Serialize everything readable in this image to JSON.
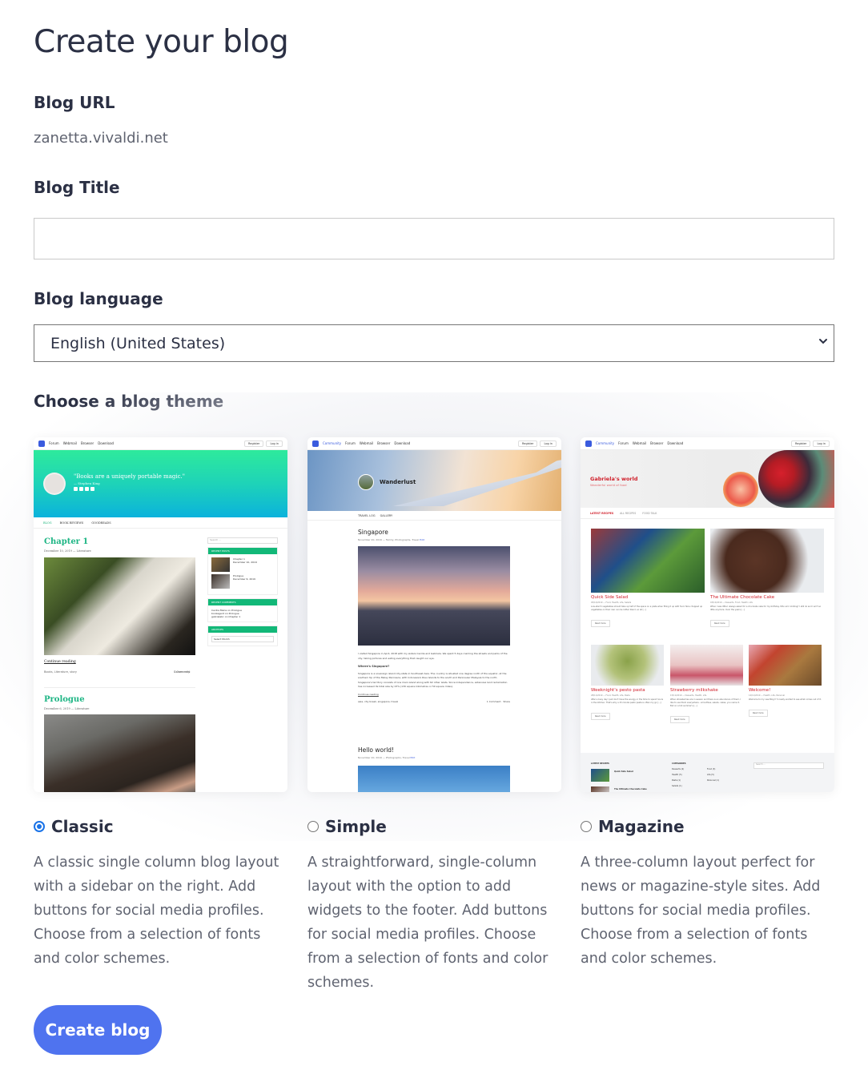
{
  "page": {
    "title": "Create your blog"
  },
  "blog_url": {
    "label": "Blog URL",
    "value": "zanetta.vivaldi.net"
  },
  "blog_title": {
    "label": "Blog Title",
    "value": ""
  },
  "blog_language": {
    "label": "Blog language",
    "selected": "English (United States)"
  },
  "themes": {
    "label": "Choose a blog theme",
    "selected": "Classic",
    "preview_nav": {
      "community": "Community",
      "forum": "Forum",
      "webmail": "Webmail",
      "browser": "Browser",
      "download": "Download",
      "register": "Register",
      "login": "Log in"
    },
    "items": [
      {
        "name": "Classic",
        "checked": true,
        "description": "A classic single column blog layout with a sidebar on the right. Add buttons for social media profiles. Choose from a selection of fonts and color schemes.",
        "preview": {
          "quote": "\"Books are a uniquely portable magic.\"",
          "quote_author": "— Stephen King",
          "nav": [
            "BLOG",
            "BOOK REVIEWS",
            "GOODREADS"
          ],
          "posts": [
            {
              "title": "Chapter 1",
              "meta": "December 10, 2019 — Literature",
              "continue": "Continue reading",
              "tags": "Books, Literature, story",
              "comments": "1 Comment",
              "share": "Share"
            },
            {
              "title": "Prologue",
              "meta": "December 6, 2019 — Literature"
            }
          ],
          "search_placeholder": "Search ...",
          "widgets": {
            "recent_posts": "RECENT POSTS",
            "recent_posts_items": [
              {
                "title": "Chapter 1",
                "date": "December 10, 2019"
              },
              {
                "title": "Prologue",
                "date": "December 6, 2019"
              }
            ],
            "recent_comments": "RECENT COMMENTS",
            "recent_comments_items": [
              "Cecilia Marie on Prologue",
              "bookagent on Prologue",
              "gabrielabc on Chapter 1"
            ],
            "archives": "ARCHIVES",
            "archives_select": "Select Month"
          }
        }
      },
      {
        "name": "Simple",
        "checked": false,
        "description": "A straightforward, single-column layout with the option to add widgets to the footer. Add buttons for social media profiles. Choose from a selection of fonts and color schemes.",
        "preview": {
          "blog_name": "Wanderlust",
          "nav": [
            "TRAVEL LOG",
            "GALLERY"
          ],
          "posts": [
            {
              "title": "Singapore",
              "meta": "November 20, 2019 — Family, Photographs, Travel",
              "edit": "Edit",
              "intro": "I visited Singapore in April, 2018 with my sisters Cecilia and Gabriela. We spent 5 days roaming the streets and parks of the city, taking pictures and eating everything that caught our eye.",
              "subheading": "Where's Singapore?",
              "body": "Singapore is a sovereign island city-state in Southeast Asia. The country is situated one degree north of the equator, at the southern tip of the Malay Peninsula, with Indonesia's Riau Islands to the south and Peninsular Malaysia to the north. Singapore's territory consists of one main island along with 62 other islets. Since independence, extensive land reclamation has increased its total size by 23% (130 square kilometres or 50 square miles).",
              "continue": "Continue reading",
              "tags": "asia, city break, singapore, travel",
              "comments": "1 Comment",
              "share": "Share"
            },
            {
              "title": "Hello world!",
              "meta": "November 20, 2019 — Photographs, Travel",
              "edit": "Edit"
            }
          ]
        }
      },
      {
        "name": "Magazine",
        "checked": false,
        "description": "A three-column layout perfect for news or magazine-style sites. Add buttons for social media profiles. Choose from a selection of fonts and color schemes.",
        "preview": {
          "blog_name": "Gabriela's world",
          "tagline": "Wonderful world of food",
          "nav": [
            "LATEST RECIPES",
            "ALL RECIPES",
            "FOOD TALK"
          ],
          "posts": [
            {
              "title": "Quick Side Salad",
              "meta": "05/12/2019 — Food, Health, Life, Salads",
              "excerpt": "Low-starch vegetables should take up half of the space on a plate when filling it up with food. Nice chopped up vegetables on their own can be rather bland, so all [...]",
              "more": "Read more"
            },
            {
              "title": "The Ultimate Chocolate Cake",
              "meta": "03/12/2019 — Desserts, Food, Health, Life",
              "excerpt": "When I was little I always asked for a chocolate cake for my birthday. Who am I kidding? I still do and I am't so little anymore. Over the years [...]",
              "more": "Read more"
            },
            {
              "title": "Weeknight's pesto pasta",
              "meta": "28/11/2019 — Food, Health, Life, Pasta",
              "excerpt": "After a busy day I just don't have the energy or the time to spend hours in the kitchen. That's why a 15 minute pesto pasta is often my go [...]",
              "more": "Read more"
            },
            {
              "title": "Strawberry milkshake",
              "meta": "15/11/2019 — Desserts, Health, Life",
              "excerpt": "When strawberries are in season and there is an abundance of them, I like to use them everywhere - smoothies, salads, cakes, you name it. But on a hot summer's [...]",
              "more": "Read more"
            },
            {
              "title": "Welcome!",
              "meta": "14/11/2019 — Health, Life, Personal",
              "excerpt": "Welcome to my new Blog! I'm really excited to see what comes out of it.",
              "more": "Read more"
            }
          ],
          "footer": {
            "latest_recipes": "LATEST RECIPES",
            "latest_items": [
              "Quick Side Salad",
              "The Ultimate Chocolate Cake"
            ],
            "categories": "CATEGORIES",
            "category_items": [
              "Desserts (2)",
              "Health (5)",
              "Pasta (1)",
              "Salads (1)",
              "Food (3)",
              "Life (5)",
              "Personal (1)"
            ],
            "search_placeholder": "Search ..."
          }
        }
      }
    ]
  },
  "actions": {
    "create_label": "Create blog"
  },
  "colors": {
    "accent": "#4f73ef",
    "radio_checked": "#1a73e8",
    "heading_text": "#2b3044",
    "body_text": "#5f6370",
    "classic_green": "#1db584",
    "magazine_red": "#d0212c"
  }
}
